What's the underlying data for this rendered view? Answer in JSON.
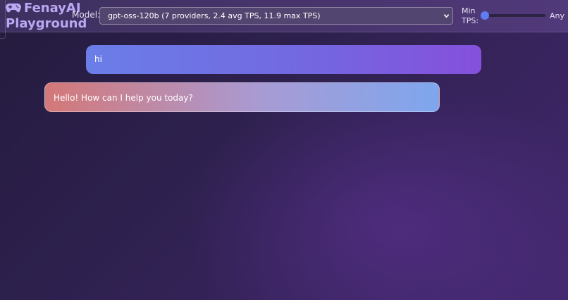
{
  "app": {
    "title_line1": "FenayAI",
    "title_line2": "Playground",
    "logo_icon": "gamepad-icon"
  },
  "toolbar": {
    "model_label": "Model:",
    "model_selected": "gpt-oss-120b (7 providers, 2.4 avg TPS, 11.9 max TPS)",
    "min_tps_label_line1": "Min",
    "min_tps_label_line2": "TPS:",
    "min_tps_slider_fraction": 0,
    "min_tps_value": "Any"
  },
  "chat": {
    "messages": [
      {
        "role": "user",
        "text": "hi"
      },
      {
        "role": "assistant",
        "text": "Hello! How can I help you today?"
      }
    ]
  },
  "colors": {
    "brand_text": "#b9a8f2",
    "user_bubble_start": "#6a7ee8",
    "user_bubble_end": "#8550dc",
    "assistant_bubble_start": "#d47878",
    "assistant_bubble_end": "#7ea6ee",
    "slider_thumb": "#5f7cf0"
  }
}
